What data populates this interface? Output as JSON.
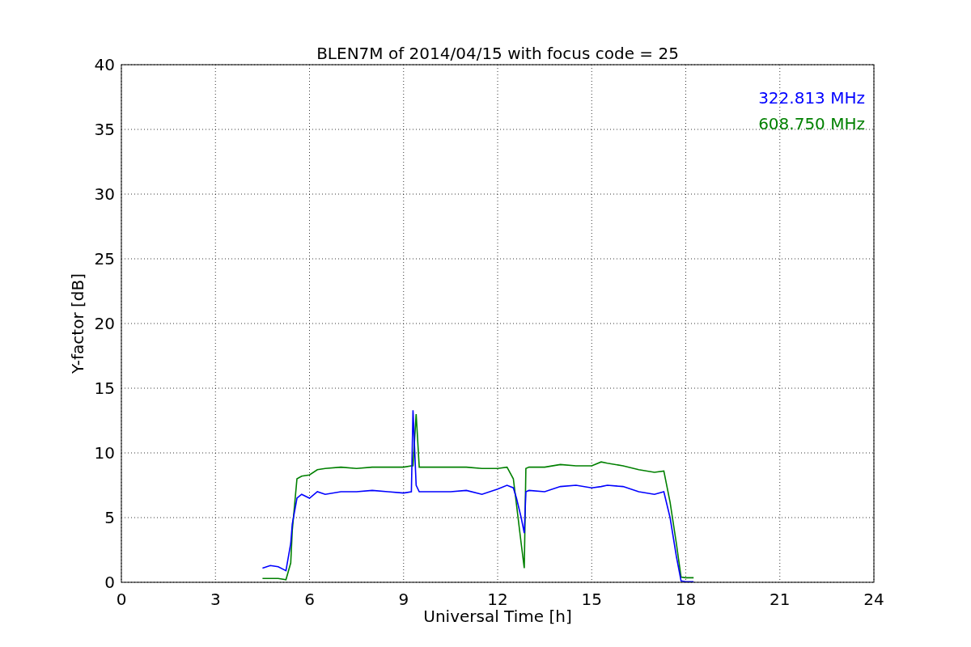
{
  "figure": {
    "chart_data": {
      "type": "line",
      "title": "BLEN7M of 2014/04/15 with focus code = 25",
      "xlabel": "Universal Time [h]",
      "ylabel": "Y-factor [dB]",
      "x": [
        4.5,
        4.75,
        5.0,
        5.25,
        5.4,
        5.45,
        5.6,
        5.75,
        6.0,
        6.25,
        6.5,
        7.0,
        7.5,
        8.0,
        8.5,
        9.0,
        9.25,
        9.3,
        9.4,
        9.5,
        10.0,
        10.5,
        11.0,
        11.5,
        12.0,
        12.3,
        12.5,
        12.6,
        12.75,
        12.85,
        12.9,
        13.0,
        13.5,
        14.0,
        14.5,
        15.0,
        15.3,
        15.5,
        16.0,
        16.5,
        17.0,
        17.3,
        17.5,
        17.7,
        17.85,
        18.0,
        18.25
      ],
      "series": [
        {
          "name": "322.813 MHz",
          "color": "#0000ff",
          "values": [
            1.1,
            1.3,
            1.2,
            0.9,
            3.0,
            4.5,
            6.5,
            6.8,
            6.5,
            7.0,
            6.8,
            7.0,
            7.0,
            7.1,
            7.0,
            6.9,
            7.0,
            13.3,
            7.5,
            7.0,
            7.0,
            7.0,
            7.1,
            6.8,
            7.2,
            7.5,
            7.3,
            6.5,
            5.0,
            3.8,
            7.0,
            7.1,
            7.0,
            7.4,
            7.5,
            7.3,
            7.4,
            7.5,
            7.4,
            7.0,
            6.8,
            7.0,
            5.0,
            2.0,
            0.1,
            0.05,
            0.05
          ]
        },
        {
          "name": "608.750 MHz",
          "color": "#008000",
          "values": [
            0.3,
            0.3,
            0.3,
            0.2,
            1.5,
            4.0,
            8.0,
            8.2,
            8.3,
            8.7,
            8.8,
            8.9,
            8.8,
            8.9,
            8.9,
            8.9,
            9.0,
            9.0,
            13.0,
            8.9,
            8.9,
            8.9,
            8.9,
            8.8,
            8.8,
            8.9,
            8.0,
            6.0,
            3.0,
            1.1,
            8.8,
            8.9,
            8.9,
            9.1,
            9.0,
            9.0,
            9.3,
            9.2,
            9.0,
            8.7,
            8.5,
            8.6,
            6.2,
            3.0,
            0.4,
            0.35,
            0.35
          ]
        }
      ],
      "grid": true,
      "xlim": [
        0,
        24
      ],
      "ylim": [
        0,
        40
      ],
      "xticks": [
        0,
        3,
        6,
        9,
        12,
        15,
        18,
        21,
        24
      ],
      "yticks": [
        0,
        5,
        10,
        15,
        20,
        25,
        30,
        35,
        40
      ]
    }
  }
}
